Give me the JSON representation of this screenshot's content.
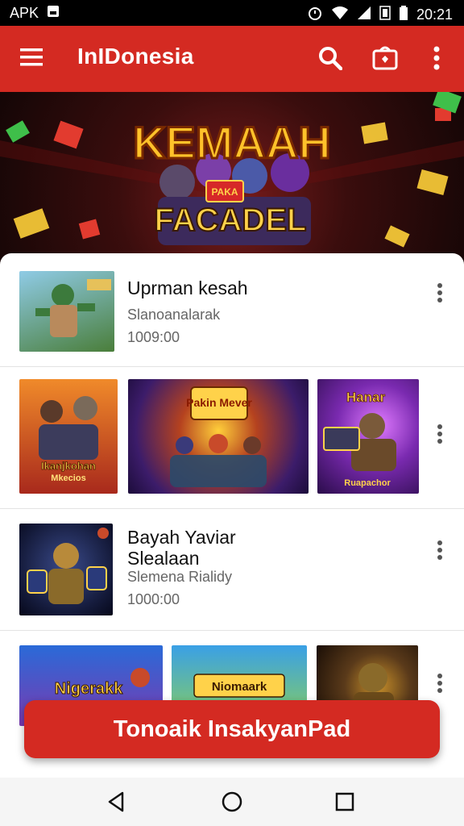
{
  "status_bar": {
    "left_text": "APK",
    "time": "20:21"
  },
  "app_bar": {
    "title": "InIDonesia"
  },
  "banner": {
    "headline": "KEMAAH",
    "subline": "FACADEL",
    "badge": "PAKA"
  },
  "list": {
    "item1": {
      "title": "Uprman kesah",
      "subtitle": "Slanoanalarak",
      "meta": "1009:00"
    },
    "gallery1": [
      {
        "label": "Ikanjkohan",
        "sublabel": "Mkecios"
      },
      {
        "label": "Pakin Mever",
        "sublabel": ""
      },
      {
        "label": "Hanar",
        "sublabel": "Ruapachor"
      }
    ],
    "item2": {
      "title": "Bayah Yaviar Slealaan",
      "subtitle": "Slemena Rialidy",
      "meta": "1000:00"
    },
    "gallery2": [
      {
        "label": "Nigerakk"
      },
      {
        "label": "Niomaark"
      },
      {
        "label": ""
      }
    ]
  },
  "cta": {
    "label": "Tonoaik InsakyanPad"
  },
  "colors": {
    "primary": "#d42a22",
    "text": "#111111",
    "muted": "#666666"
  }
}
